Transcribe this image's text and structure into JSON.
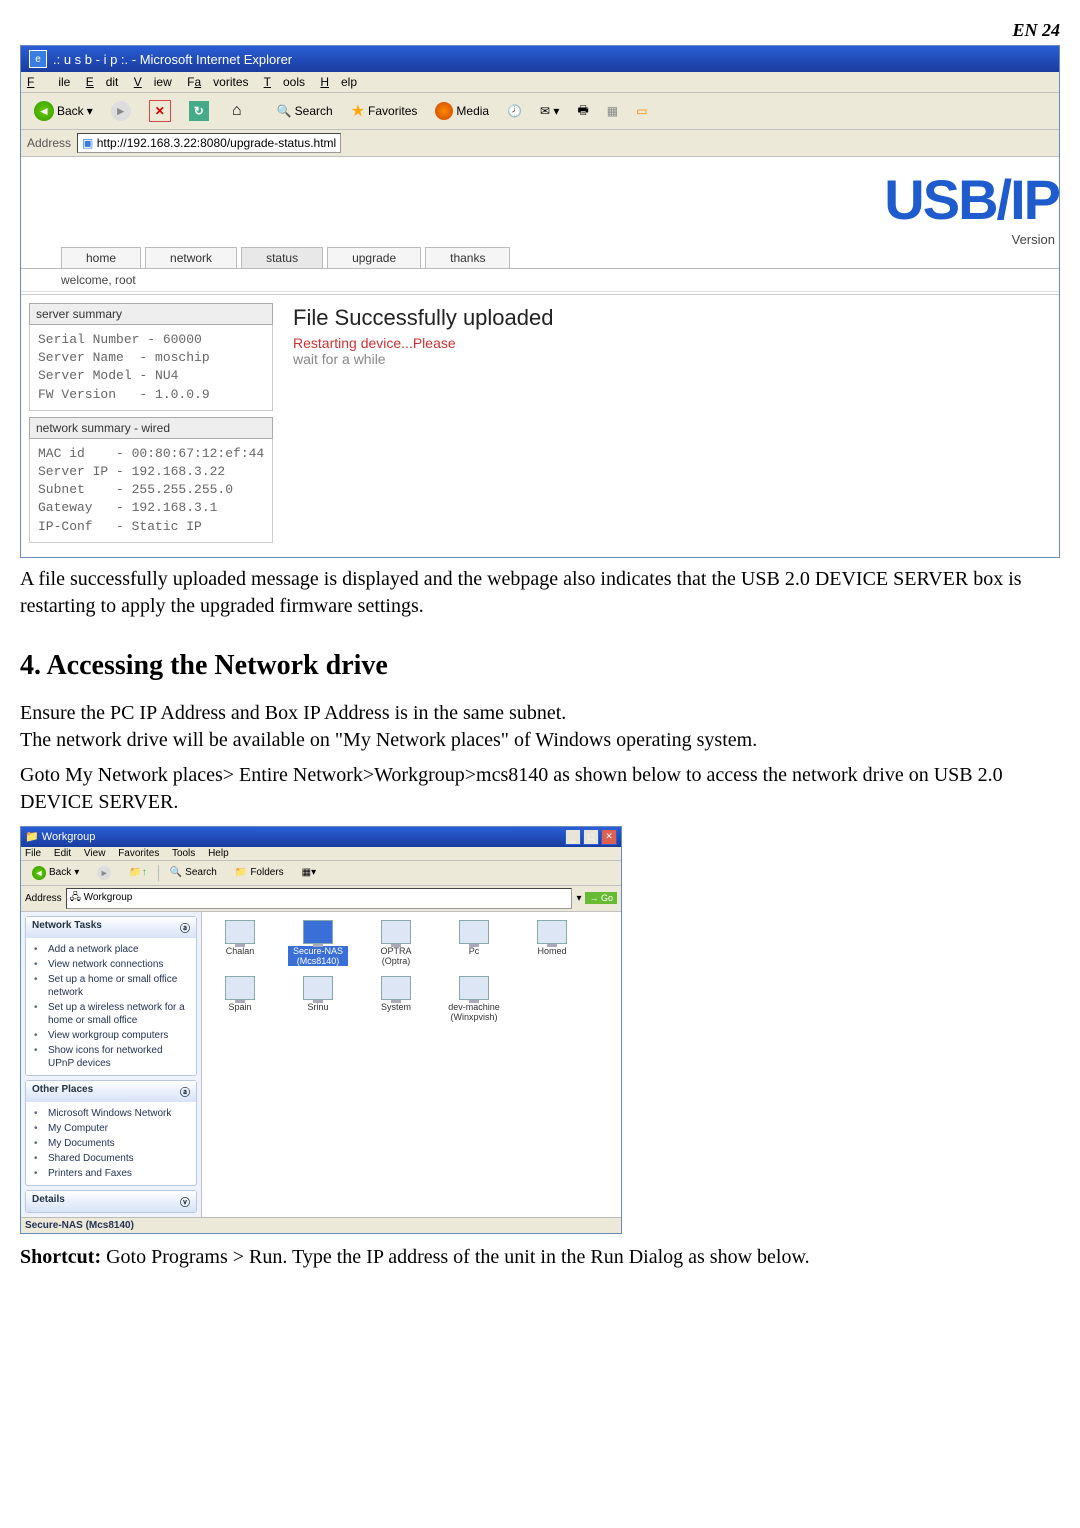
{
  "page_num": "EN 24",
  "ie": {
    "title": ".: u s b - i p :. - Microsoft Internet Explorer",
    "menu": {
      "file": "File",
      "edit": "Edit",
      "view": "View",
      "favorites": "Favorites",
      "tools": "Tools",
      "help": "Help"
    },
    "toolbar": {
      "back": "Back",
      "search": "Search",
      "favorites": "Favorites",
      "media": "Media"
    },
    "address_label": "Address",
    "address_value": "http://192.168.3.22:8080/upgrade-status.html",
    "logo": "USB/IP",
    "version_label": "Version",
    "tabs": {
      "home": "home",
      "network": "network",
      "status": "status",
      "upgrade": "upgrade",
      "thanks": "thanks"
    },
    "welcome": "welcome, root",
    "server_summary": {
      "title": "server summary",
      "body": "Serial Number - 60000\nServer Name  - moschip\nServer Model - NU4\nFW Version   - 1.0.0.9"
    },
    "network_summary": {
      "title": "network summary - wired",
      "body": "MAC id    - 00:80:67:12:ef:44\nServer IP - 192.168.3.22\nSubnet    - 255.255.255.0\nGateway   - 192.168.3.1\nIP-Conf   - Static IP"
    },
    "main_heading": "File Successfully uploaded",
    "restarting": "Restarting device...Please",
    "wait_msg": "wait for a while"
  },
  "para1": "A file successfully uploaded message is displayed and the webpage also indicates that the USB 2.0 DEVICE SERVER box is restarting to apply the upgraded firmware settings.",
  "section_heading": " 4. Accessing the Network drive",
  "para2a": "Ensure the PC IP Address and Box IP Address is in the same subnet.",
  "para2b": "The network drive will be available on \"My Network places\" of Windows operating system.",
  "para3": "Goto My Network places> Entire Network>Workgroup>mcs8140 as shown below to access the network drive on USB 2.0 DEVICE SERVER.",
  "explorer": {
    "title": "Workgroup",
    "menu": {
      "file": "File",
      "edit": "Edit",
      "view": "View",
      "favorites": "Favorites",
      "tools": "Tools",
      "help": "Help"
    },
    "toolbar": {
      "back": "Back",
      "search": "Search",
      "folders": "Folders"
    },
    "address_label": "Address",
    "address_value": "Workgroup",
    "go": "Go",
    "side": {
      "network_tasks": {
        "title": "Network Tasks",
        "items": [
          "Add a network place",
          "View network connections",
          "Set up a home or small office network",
          "Set up a wireless network for a home or small office",
          "View workgroup computers",
          "Show icons for networked UPnP devices"
        ]
      },
      "other_places": {
        "title": "Other Places",
        "items": [
          "Microsoft Windows Network",
          "My Computer",
          "My Documents",
          "Shared Documents",
          "Printers and Faxes"
        ]
      },
      "details": {
        "title": "Details"
      }
    },
    "icons": [
      "Chalan",
      "Secure-NAS (Mcs8140)",
      "OPTRA (Optra)",
      "Pc",
      "Homed",
      "Spain",
      "Srinu",
      "System",
      "dev-machine (Winxpvish)"
    ],
    "selected": "Secure-NAS (Mcs8140)",
    "status": "Secure-NAS (Mcs8140)"
  },
  "para4_label": "Shortcut:",
  "para4": " Goto Programs > Run. Type the IP address of the unit in the Run Dialog as show below."
}
